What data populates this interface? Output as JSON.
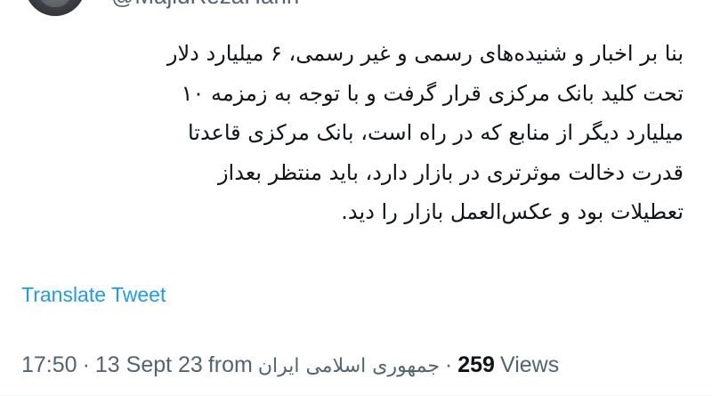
{
  "author": {
    "handle": "@MajidRezaHariri"
  },
  "tweet": {
    "lines": [
      "بنا بر اخبار و شنیده‌های رسمی و غیر رسمی، ۶ میلیارد دلار",
      "تحت کلید بانک مرکزی قرار گرفت و با توجه به زمزمه ۱۰",
      "میلیارد دیگر از منابع که در راه است، بانک مرکزی قاعدتا",
      "قدرت دخالت موثرتری در بازار دارد، باید منتظر بعداز",
      "تعطیلات بود و عکس‌العمل بازار را دید."
    ],
    "translate_label": "Translate Tweet"
  },
  "meta": {
    "time": "17:50",
    "separator": "·",
    "date": "13 Sept 23",
    "from_label": "from",
    "source": "جمهوری اسلامی ایران",
    "views_count": "259",
    "views_label": "Views"
  },
  "colors": {
    "link": "#1d9bf0",
    "muted": "#536471",
    "text": "#0f1419"
  }
}
